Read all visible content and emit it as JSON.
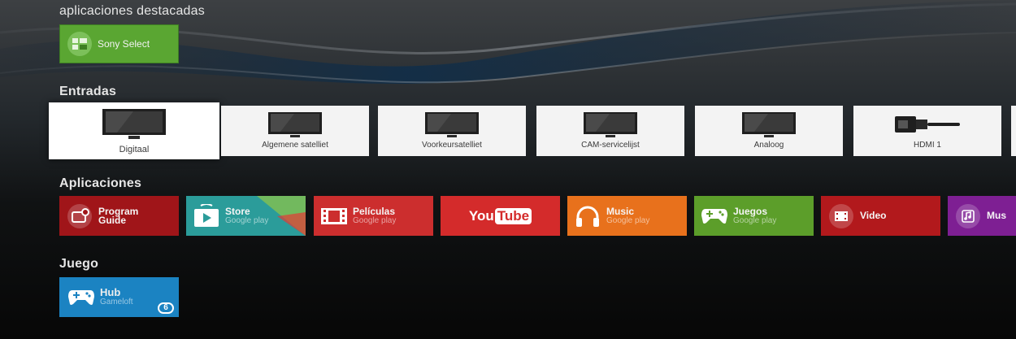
{
  "sections": {
    "featured": "aplicaciones destacadas",
    "inputs": "Entradas",
    "apps": "Aplicaciones",
    "games": "Juego"
  },
  "featured": {
    "label": "Sony Select",
    "icon": "sony-select-icon",
    "color": "#5aa632"
  },
  "inputs": [
    {
      "label": "Digitaal",
      "icon": "tv-icon",
      "focused": true
    },
    {
      "label": "Algemene satelliet",
      "icon": "tv-icon"
    },
    {
      "label": "Voorkeursatelliet",
      "icon": "tv-icon"
    },
    {
      "label": "CAM-servicelijst",
      "icon": "tv-icon"
    },
    {
      "label": "Analoog",
      "icon": "tv-icon"
    },
    {
      "label": "HDMI 1",
      "icon": "hdmi-icon"
    }
  ],
  "apps": [
    {
      "name": "Program",
      "name2": "Guide",
      "icon": "program-guide-icon",
      "color": "#a01519"
    },
    {
      "name": "Store",
      "sub": "Google play",
      "icon": "play-store-icon",
      "color": "#2b9c9a"
    },
    {
      "name": "Películas",
      "sub": "Google play",
      "icon": "film-strip-icon",
      "color": "#cc2e2e"
    },
    {
      "name": "YouTube",
      "icon": "youtube-logo",
      "color": "#d42b2b"
    },
    {
      "name": "Music",
      "sub": "Google play",
      "icon": "headphones-icon",
      "color": "#e8711c"
    },
    {
      "name": "Juegos",
      "sub": "Google play",
      "icon": "gamepad-icon",
      "color": "#5c9e2a"
    },
    {
      "name": "Video",
      "icon": "video-icon",
      "color": "#b2191c"
    },
    {
      "name": "Mus",
      "icon": "music-note-icon",
      "color": "#7e1f93"
    }
  ],
  "games": [
    {
      "name": "Hub",
      "sub": "Gameloft",
      "badge": "6",
      "icon": "gamepad-icon",
      "color": "#1b83c2"
    }
  ]
}
